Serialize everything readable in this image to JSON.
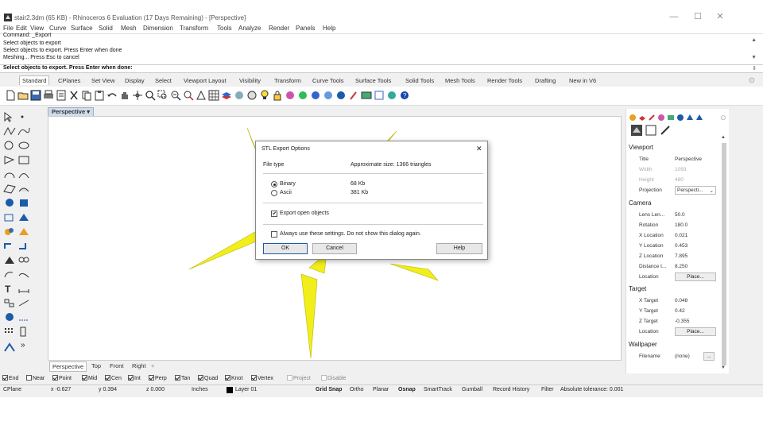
{
  "window": {
    "title": "stair2.3dm (65 KB) - Rhinoceros 6 Evaluation (17 Days Remaining) - [Perspective]",
    "minimize": "—",
    "maximize": "☐",
    "close": "✕"
  },
  "menu": [
    "File",
    "Edit",
    "View",
    "Curve",
    "Surface",
    "Solid",
    "Mesh",
    "Dimension",
    "Transform",
    "Tools",
    "Analyze",
    "Render",
    "Panels",
    "Help"
  ],
  "command_history": [
    "Command: _Export",
    "Select objects to export",
    "Select objects to export. Press Enter when done",
    "Meshing... Press Esc to cancel"
  ],
  "command_prompt": "Select objects to export. Press Enter when done:",
  "toolbar_tabs": [
    "Standard",
    "CPlanes",
    "Set View",
    "Display",
    "Select",
    "Viewport Layout",
    "Visibility",
    "Transform",
    "Curve Tools",
    "Surface Tools",
    "Solid Tools",
    "Mesh Tools",
    "Render Tools",
    "Drafting",
    "New in V6"
  ],
  "viewport": {
    "title": "Perspective",
    "dropdown_glyph": "▾",
    "tabs": [
      "Perspective",
      "Top",
      "Front",
      "Right"
    ],
    "add_tab": "+"
  },
  "dialog": {
    "title": "STL Export Options",
    "close": "✕",
    "file_type_label": "File type",
    "approx_size": "Approximate size: 1366 triangles",
    "options": [
      {
        "label": "Binary",
        "size": "68 Kb",
        "selected": true
      },
      {
        "label": "Ascii",
        "size": "381 Kb",
        "selected": false
      }
    ],
    "export_open": "Export open objects",
    "export_open_checked": true,
    "always_use": "Always use these settings. Do not show this dialog again.",
    "always_use_checked": false,
    "ok": "OK",
    "cancel": "Cancel",
    "help": "Help"
  },
  "properties": {
    "viewport_header": "Viewport",
    "viewport_rows": [
      {
        "label": "Title",
        "value": "Perspective",
        "grey": false
      },
      {
        "label": "Width",
        "value": "1093",
        "grey": true
      },
      {
        "label": "Height",
        "value": "480",
        "grey": true
      },
      {
        "label": "Projection",
        "value": "Perspecti...",
        "grey": false
      }
    ],
    "camera_header": "Camera",
    "camera_rows": [
      {
        "label": "Lens Len...",
        "value": "50.0"
      },
      {
        "label": "Rotation",
        "value": "180.0"
      },
      {
        "label": "X Location",
        "value": "0.021"
      },
      {
        "label": "Y Location",
        "value": "0.453"
      },
      {
        "label": "Z Location",
        "value": "7.895"
      },
      {
        "label": "Distance t...",
        "value": "8.250"
      }
    ],
    "camera_location_label": "Location",
    "place_button": "Place...",
    "target_header": "Target",
    "target_rows": [
      {
        "label": "X Target",
        "value": "0.048"
      },
      {
        "label": "Y Target",
        "value": "0.42"
      },
      {
        "label": "Z Target",
        "value": "-0.355"
      }
    ],
    "target_location_label": "Location",
    "wallpaper_header": "Wallpaper",
    "filename_label": "Filename",
    "filename_value": "(none)",
    "browse": "..."
  },
  "osnaps": [
    {
      "label": "End",
      "checked": true,
      "disabled": false
    },
    {
      "label": "Near",
      "checked": false,
      "disabled": false
    },
    {
      "label": "Point",
      "checked": true,
      "disabled": false
    },
    {
      "label": "Mid",
      "checked": true,
      "disabled": false
    },
    {
      "label": "Cen",
      "checked": true,
      "disabled": false
    },
    {
      "label": "Int",
      "checked": true,
      "disabled": false
    },
    {
      "label": "Perp",
      "checked": true,
      "disabled": false
    },
    {
      "label": "Tan",
      "checked": true,
      "disabled": false
    },
    {
      "label": "Quad",
      "checked": true,
      "disabled": false
    },
    {
      "label": "Knot",
      "checked": true,
      "disabled": false
    },
    {
      "label": "Vertex",
      "checked": true,
      "disabled": false
    },
    {
      "label": "Project",
      "checked": false,
      "disabled": true
    },
    {
      "label": "Disable",
      "checked": false,
      "disabled": true
    }
  ],
  "status": {
    "cplane": "CPlane",
    "x": "x -0.627",
    "y": "y 0.394",
    "z": "z 0.000",
    "units": "Inches",
    "layer": "Layer 01",
    "toggles": [
      {
        "label": "Grid Snap",
        "bold": true
      },
      {
        "label": "Ortho",
        "bold": false
      },
      {
        "label": "Planar",
        "bold": false
      },
      {
        "label": "Osnap",
        "bold": true
      },
      {
        "label": "SmartTrack",
        "bold": false
      },
      {
        "label": "Gumball",
        "bold": false
      },
      {
        "label": "Record History",
        "bold": false
      },
      {
        "label": "Filter",
        "bold": false
      }
    ],
    "tolerance": "Absolute tolerance: 0.001"
  },
  "colors": {
    "model_fill": "#f2ee1a",
    "model_stroke": "#b8b400",
    "viewport_tab_bg": "#cfdcec"
  }
}
